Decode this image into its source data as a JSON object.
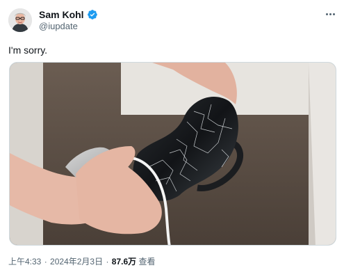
{
  "author": {
    "display_name": "Sam Kohl",
    "handle": "@iupdate",
    "verified": true,
    "verified_badge_color": "#1d9bf0"
  },
  "more_icon": "more-horizontal-icon",
  "tweet": {
    "text": "I'm sorry."
  },
  "meta": {
    "time": "上午4:33",
    "separator": "·",
    "date": "2024年2月3日",
    "views_count": "87.6万",
    "views_label": "查看"
  },
  "colors": {
    "text_primary": "#0f1419",
    "text_secondary": "#536471",
    "border": "#cfd9de"
  }
}
